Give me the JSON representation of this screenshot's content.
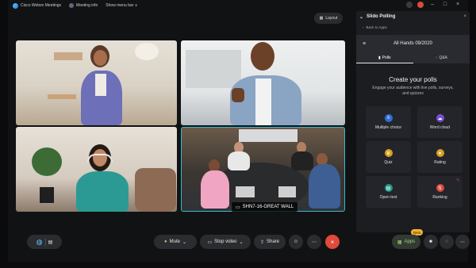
{
  "titlebar": {
    "app_name": "Cisco Webex Meetings",
    "meeting_info": "Meeting info",
    "menu_bar": "Show menu bar ∨"
  },
  "layout_button": "Layout",
  "name_tag": "SHN7-16-GREAT WALL",
  "panel": {
    "title": "Slido Polling",
    "back": "Back to Apps",
    "event": "All Hands 09/2020",
    "tabs": [
      {
        "label": "Polls",
        "icon": "bar-chart-icon"
      },
      {
        "label": "Q&A",
        "icon": "chat-bubble-icon"
      }
    ],
    "heading": "Create your polls",
    "subtext": "Engage your audience with live polls, surveys, and quizzes",
    "options": [
      {
        "label": "Multiple choice",
        "icon": "list-icon",
        "color": "#2f6fd6"
      },
      {
        "label": "Word cloud",
        "icon": "cloud-icon",
        "color": "#7b4fd6"
      },
      {
        "label": "Quiz",
        "icon": "trophy-icon",
        "color": "#d9a01e"
      },
      {
        "label": "Rating",
        "icon": "star-icon",
        "color": "#d9a01e"
      },
      {
        "label": "Open text",
        "icon": "text-bubble-icon",
        "color": "#1f9a8a"
      },
      {
        "label": "Ranking",
        "icon": "ranking-icon",
        "color": "#d94b3b"
      }
    ]
  },
  "toolbar": {
    "mute": "Mute",
    "stop_video": "Stop video",
    "share": "Share",
    "apps": "Apps",
    "beta": "Beta"
  },
  "colors": {
    "accent": "#3cb8c9",
    "leave": "#e04a3a",
    "beta": "#f2b134",
    "apps": "#9bd47a"
  }
}
